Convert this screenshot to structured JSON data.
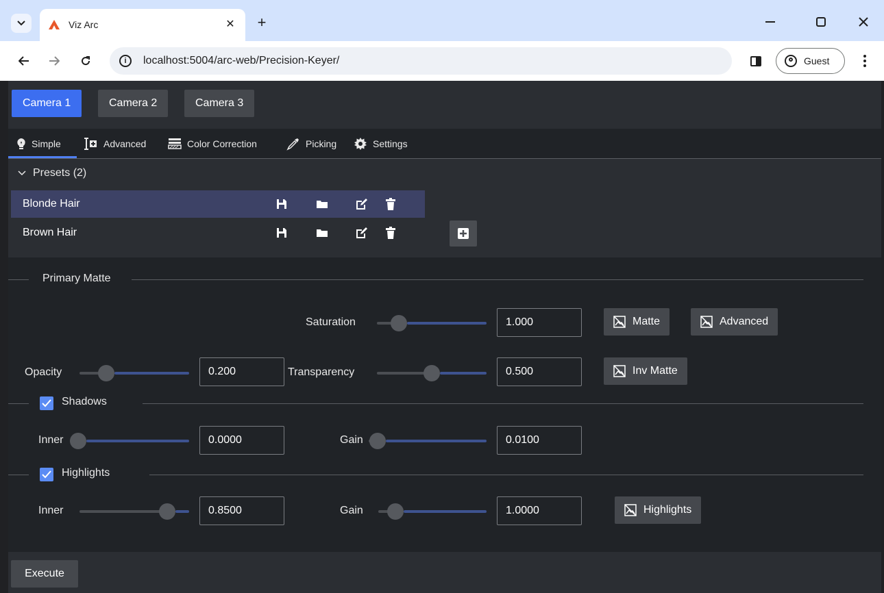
{
  "browser": {
    "tab_title": "Viz Arc",
    "url": "localhost:5004/arc-web/Precision-Keyer/",
    "profile_label": "Guest",
    "favicon_color": "#e8572a"
  },
  "cameras": [
    {
      "label": "Camera 1",
      "active": true
    },
    {
      "label": "Camera 2",
      "active": false
    },
    {
      "label": "Camera 3",
      "active": false
    }
  ],
  "subtabs": [
    {
      "label": "Simple",
      "icon": "lightbulb-icon",
      "active": true
    },
    {
      "label": "Advanced",
      "icon": "advanced-icon"
    },
    {
      "label": "Color Correction",
      "icon": "color-correction-icon"
    },
    {
      "label": "Picking",
      "icon": "eyedropper-icon"
    },
    {
      "label": "Settings",
      "icon": "gear-icon"
    }
  ],
  "presets": {
    "header": "Presets (2)",
    "items": [
      {
        "name": "Blonde Hair",
        "selected": true
      },
      {
        "name": "Brown Hair",
        "selected": false
      }
    ]
  },
  "primary_matte": {
    "title": "Primary Matte",
    "saturation": {
      "label": "Saturation",
      "value": "1.000",
      "fraction": 0.15
    },
    "opacity": {
      "label": "Opacity",
      "value": "0.200",
      "fraction": 0.2
    },
    "transparency": {
      "label": "Transparency",
      "value": "0.500",
      "fraction": 0.5
    },
    "matte_button": "Matte",
    "advanced_button": "Advanced",
    "inv_matte_button": "Inv Matte"
  },
  "shadows": {
    "title": "Shadows",
    "checked": true,
    "inner": {
      "label": "Inner",
      "value": "0.0000",
      "fraction": 0.0
    },
    "gain": {
      "label": "Gain",
      "value": "0.0100",
      "fraction": 0.01
    }
  },
  "highlights": {
    "title": "Highlights",
    "checked": true,
    "inner": {
      "label": "Inner",
      "value": "0.8500",
      "fraction": 0.85
    },
    "gain": {
      "label": "Gain",
      "value": "1.0000",
      "fraction": 0.1
    },
    "highlights_button": "Highlights"
  },
  "execute_label": "Execute",
  "colors": {
    "accent": "#3c6ef0",
    "selected_row": "#3d4266",
    "slider_track": "#3e5390"
  }
}
